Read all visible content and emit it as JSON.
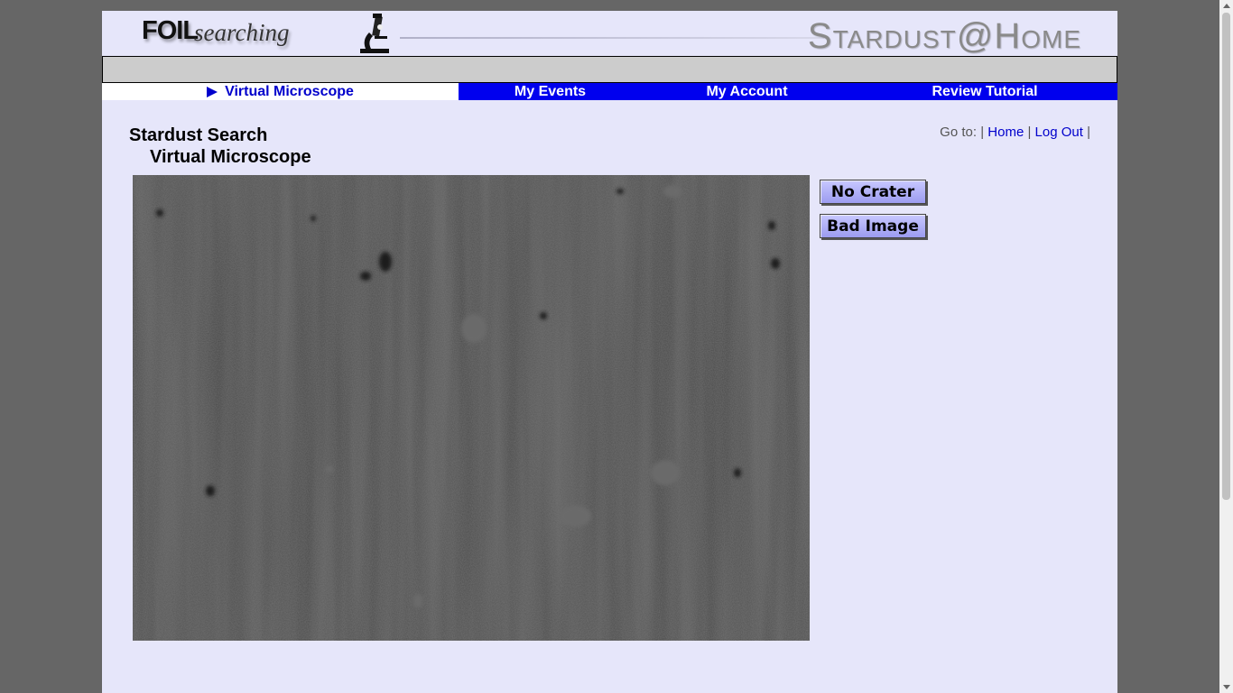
{
  "banner": {
    "foil_text": "FOIL",
    "searching_text": "searching",
    "site_text": "Stardust@Home"
  },
  "nav": {
    "items": [
      {
        "label": "Virtual Microscope",
        "active": true
      },
      {
        "label": "My Events",
        "active": false
      },
      {
        "label": "My Account",
        "active": false
      },
      {
        "label": "Review Tutorial",
        "active": false
      }
    ]
  },
  "main": {
    "title": "Stardust Search",
    "subtitle": "Virtual Microscope"
  },
  "goto": {
    "prefix": "Go to:",
    "separator": "|",
    "links": [
      "Home",
      "Log Out"
    ]
  },
  "actions": {
    "no_crater": "No Crater",
    "bad_image": "Bad Image"
  },
  "colors": {
    "page_bg": "#e6e6fa",
    "nav_bg": "#0000ee",
    "button_bg": "#aaaaf5"
  },
  "icons": {
    "microscope": "microscope-icon",
    "nav_arrow": "play-arrow-icon"
  }
}
